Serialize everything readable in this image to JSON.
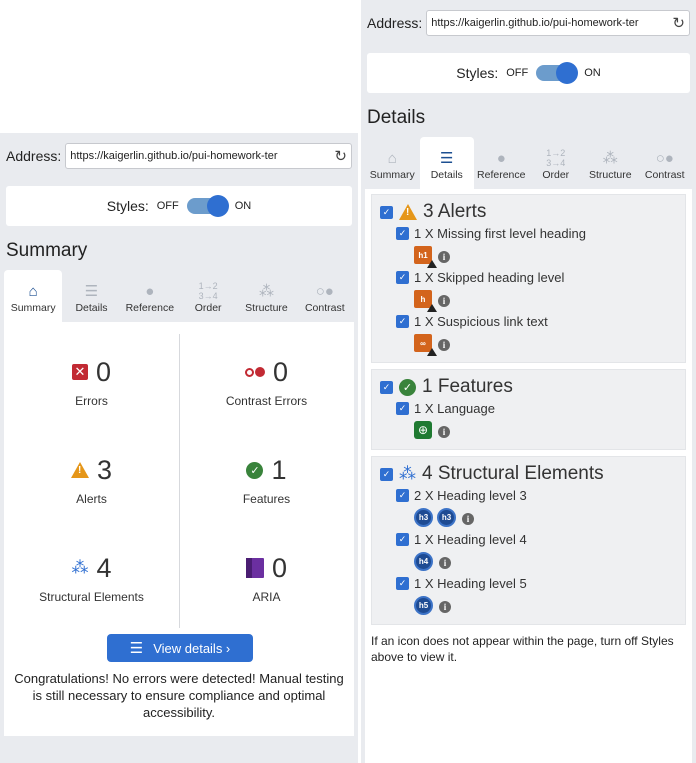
{
  "address": {
    "label": "Address:",
    "url": "https://kaigerlin.github.io/pui-homework-ter"
  },
  "styles": {
    "label": "Styles:",
    "off": "OFF",
    "on": "ON"
  },
  "tabs": [
    {
      "label": "Summary",
      "icon": "home-icon"
    },
    {
      "label": "Details",
      "icon": "list-icon"
    },
    {
      "label": "Reference",
      "icon": "info-icon"
    },
    {
      "label": "Order",
      "icon": "order-icon"
    },
    {
      "label": "Structure",
      "icon": "tree-icon"
    },
    {
      "label": "Contrast",
      "icon": "contrast-icon"
    }
  ],
  "summary": {
    "title": "Summary",
    "stats": [
      {
        "num": "0",
        "label": "Errors",
        "icon": "error-icon"
      },
      {
        "num": "0",
        "label": "Contrast Errors",
        "icon": "contrast-error-icon"
      },
      {
        "num": "3",
        "label": "Alerts",
        "icon": "alert-icon"
      },
      {
        "num": "1",
        "label": "Features",
        "icon": "feature-icon"
      },
      {
        "num": "4",
        "label": "Structural Elements",
        "icon": "structure-icon"
      },
      {
        "num": "0",
        "label": "ARIA",
        "icon": "aria-icon"
      }
    ],
    "view_details": "View details ›",
    "congrats": "Congratulations! No errors were detected! Manual testing is still necessary to ensure compliance and optimal accessibility."
  },
  "details": {
    "title": "Details",
    "alerts": {
      "heading": "3 Alerts",
      "items": [
        {
          "text": "1 X Missing first level heading",
          "icon_text": "h1"
        },
        {
          "text": "1 X Skipped heading level",
          "icon_text": "h"
        },
        {
          "text": "1 X Suspicious link text",
          "icon_text": "∞"
        }
      ]
    },
    "features": {
      "heading": "1 Features",
      "items": [
        {
          "text": "1 X Language",
          "icon_text": "⊕"
        }
      ]
    },
    "structure": {
      "heading": "4 Structural Elements",
      "items": [
        {
          "text": "2 X Heading level 3",
          "icons": [
            "h3",
            "h3"
          ]
        },
        {
          "text": "1 X Heading level 4",
          "icons": [
            "h4"
          ]
        },
        {
          "text": "1 X Heading level 5",
          "icons": [
            "h5"
          ]
        }
      ]
    },
    "footnote": "If an icon does not appear within the page, turn off Styles above to view it."
  }
}
